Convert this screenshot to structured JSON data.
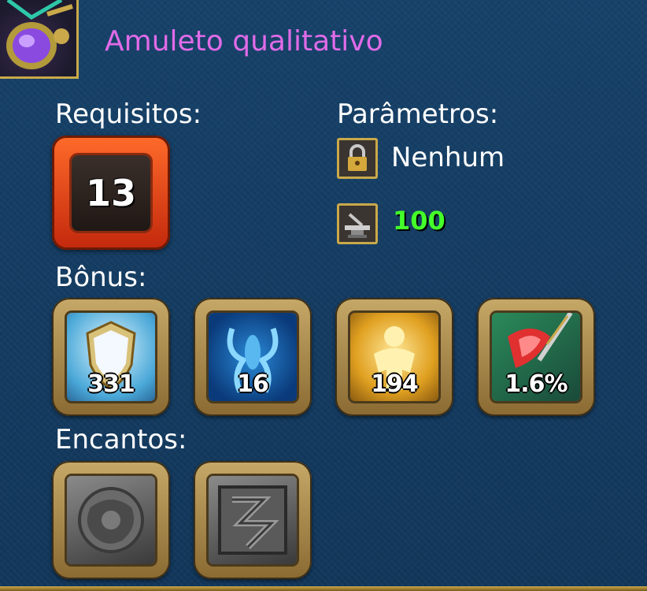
{
  "item": {
    "title": "Amuleto qualitativo",
    "icon": "purple-amulet-icon"
  },
  "requirements": {
    "label": "Requisitos:",
    "level": "13"
  },
  "parameters": {
    "label": "Parâmetros:",
    "lock": {
      "icon": "lock-icon",
      "text": "Nenhum"
    },
    "anvil": {
      "icon": "anvil-icon",
      "value": "100"
    }
  },
  "bonus": {
    "label": "Bônus:",
    "items": [
      {
        "icon": "shield-icon",
        "value": "331"
      },
      {
        "icon": "blue-aura-icon",
        "value": "16"
      },
      {
        "icon": "golden-figure-icon",
        "value": "194"
      },
      {
        "icon": "red-crystal-sword-icon",
        "value": "1.6%"
      }
    ]
  },
  "enchants": {
    "label": "Encantos:",
    "items": [
      {
        "icon": "empty-enchant-slot-icon"
      },
      {
        "icon": "empty-enchant-rune-icon"
      }
    ]
  },
  "colors": {
    "title": "#e06be8",
    "background": "#143a5c",
    "gold_border": "#c9a94a",
    "green_value": "#44ff2a",
    "level_orange": "#ff6b2a"
  }
}
